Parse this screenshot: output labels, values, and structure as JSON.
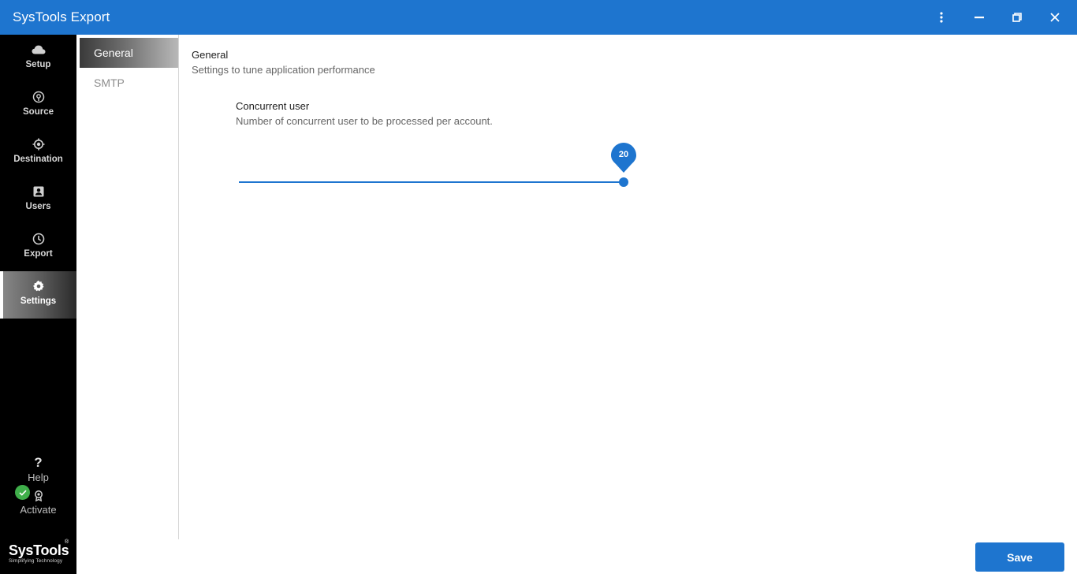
{
  "app": {
    "title": "SysTools Export"
  },
  "window_controls": {
    "menu_icon": "kebab-menu-icon",
    "minimize_icon": "minimize-icon",
    "restore_icon": "restore-icon",
    "close_icon": "close-icon"
  },
  "sidebar": {
    "items": [
      {
        "label": "Setup",
        "icon": "cloud-icon",
        "active": false
      },
      {
        "label": "Source",
        "icon": "source-icon",
        "active": false
      },
      {
        "label": "Destination",
        "icon": "target-icon",
        "active": false
      },
      {
        "label": "Users",
        "icon": "user-card-icon",
        "active": false
      },
      {
        "label": "Export",
        "icon": "clock-icon",
        "active": false
      },
      {
        "label": "Settings",
        "icon": "gear-icon",
        "active": true
      }
    ],
    "help": {
      "symbol": "?",
      "label": "Help"
    },
    "activate": {
      "label": "Activate",
      "status": "activated"
    }
  },
  "brand": {
    "name": "SysTools",
    "registered": "®",
    "tagline": "Simplifying Technology"
  },
  "subnav": {
    "tabs": [
      {
        "label": "General",
        "active": true
      },
      {
        "label": "SMTP",
        "active": false
      }
    ]
  },
  "general": {
    "title": "General",
    "description": "Settings to tune application performance",
    "concurrent_user": {
      "label": "Concurrent user",
      "description": "Number of concurrent user to be processed per account.",
      "value": "20",
      "fill_fraction": 1.0
    }
  },
  "footer": {
    "save_label": "Save"
  },
  "colors": {
    "accent": "#1e75cf",
    "sidebar_bg": "#000000",
    "success": "#3fae4a"
  }
}
